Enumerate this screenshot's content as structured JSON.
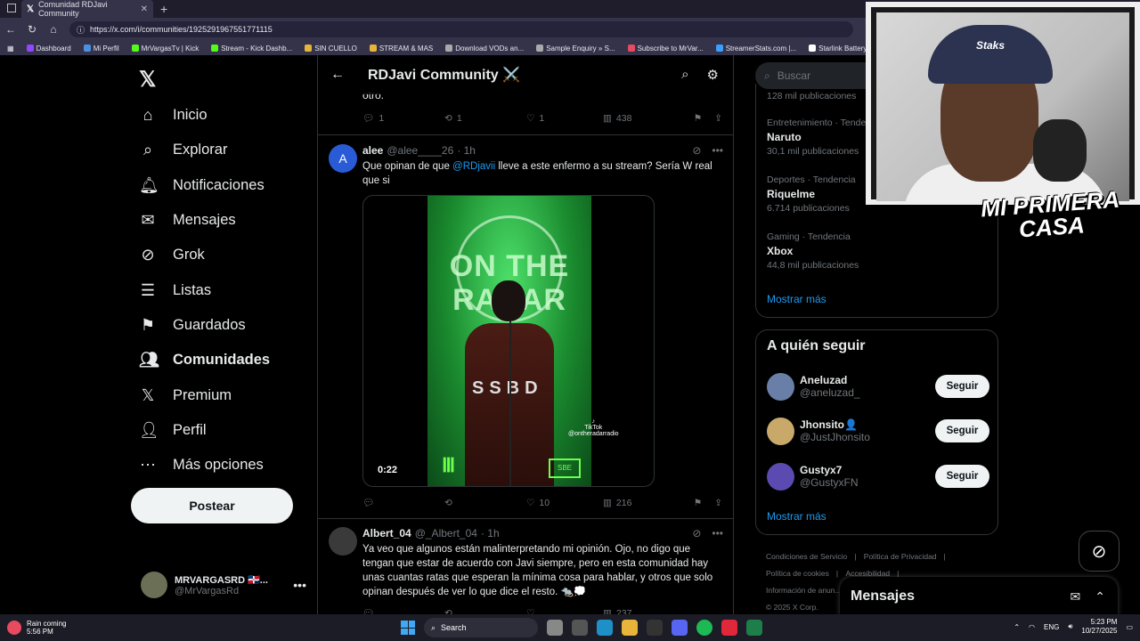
{
  "browser": {
    "tab_title": "Comunidad RDJavi Community",
    "url": "https://x.com/i/communities/1925291967551771115",
    "bookmarks": [
      "Dashboard",
      "Mi Perfil",
      "MrVargasTv | Kick",
      "Stream - Kick Dashb...",
      "SIN CUELLO",
      "STREAM & MAS",
      "Download VODs an...",
      "Sample Enquiry » S...",
      "Subscribe to MrVar...",
      "StreamerStats.com |...",
      "Starlink Battery Pow..."
    ]
  },
  "nav": {
    "items": [
      {
        "label": "Inicio",
        "icon": "home-icon",
        "glyph": "⌂"
      },
      {
        "label": "Explorar",
        "icon": "search-icon",
        "glyph": "⌕"
      },
      {
        "label": "Notificaciones",
        "icon": "bell-icon",
        "glyph": "🔔︎"
      },
      {
        "label": "Mensajes",
        "icon": "mail-icon",
        "glyph": "✉"
      },
      {
        "label": "Grok",
        "icon": "grok-icon",
        "glyph": "⊘"
      },
      {
        "label": "Listas",
        "icon": "list-icon",
        "glyph": "☰"
      },
      {
        "label": "Guardados",
        "icon": "bookmark-icon",
        "glyph": "⚑"
      },
      {
        "label": "Comunidades",
        "icon": "communities-icon",
        "glyph": "👥︎"
      },
      {
        "label": "Premium",
        "icon": "x-premium-icon",
        "glyph": "𝕏"
      },
      {
        "label": "Perfil",
        "icon": "person-icon",
        "glyph": "👤︎"
      },
      {
        "label": "Más opciones",
        "icon": "more-circle-icon",
        "glyph": "⋯"
      }
    ],
    "post_label": "Postear",
    "me": {
      "name": "MRVARGASRD 🇩🇴...",
      "handle": "@MrVargasRd"
    }
  },
  "header": {
    "title": "RDJavi Community ⚔️"
  },
  "previous_tweet": {
    "text_tail": "otro.",
    "replies": "1",
    "retweets": "1",
    "likes": "1",
    "views": "438"
  },
  "tweet1": {
    "name": "alee",
    "handle": "@alee____26",
    "time": "· 1h",
    "text_before": "Que opinan de que ",
    "mention": "@RDjavii",
    "text_after": " lleve a este enfermo a su stream? Sería W real que si",
    "video_duration": "0:22",
    "video_overlay": {
      "sign": "ON THE RADAR",
      "jacket": "SSBD",
      "tiktok": "TikTok",
      "tiktok_handle": "@ontheradarradio"
    },
    "replies": "",
    "retweets": "",
    "likes": "10",
    "views": "216"
  },
  "tweet2": {
    "name": "Albert_04",
    "handle": "@_Albert_04",
    "time": "· 1h",
    "text": "Ya veo que algunos están malinterpretando mi opinión. Ojo, no digo que tengan que estar de acuerdo con Javi siempre, pero en esta comunidad hay unas cuantas ratas que esperan la mínima cosa para hablar, y otros que solo opinan después de ver lo que dice el resto. 🐀💭",
    "views": "237"
  },
  "search": {
    "placeholder": "Buscar"
  },
  "trends": {
    "top_count": "128 mil publicaciones",
    "items": [
      {
        "meta": "Entretenimiento · Tendencia",
        "name": "Naruto",
        "count": "30,1 mil publicaciones"
      },
      {
        "meta": "Deportes · Tendencia",
        "name": "Riquelme",
        "count": "6.714 publicaciones"
      },
      {
        "meta": "Gaming · Tendencia",
        "name": "Xbox",
        "count": "44,8 mil publicaciones"
      }
    ],
    "more": "Mostrar más"
  },
  "who_to_follow": {
    "title": "A quién seguir",
    "users": [
      {
        "name": "Aneluzad",
        "handle": "@aneluzad_",
        "button": "Seguir",
        "color": "#6a7fa8"
      },
      {
        "name": "Jhonsito👤",
        "handle": "@JustJhonsito",
        "button": "Seguir",
        "color": "#c9a96a"
      },
      {
        "name": "Gustyx7",
        "handle": "@GustyxFN",
        "button": "Seguir",
        "color": "#5b4ab0"
      }
    ],
    "more": "Mostrar más"
  },
  "footer": {
    "links": [
      "Condiciones de Servicio",
      "Política de Privacidad",
      "Política de cookies",
      "Accesibilidad",
      "Información de anun..."
    ],
    "copyright": "© 2025 X Corp."
  },
  "messages_dock": {
    "title": "Mensajes"
  },
  "webcam": {
    "cap_text": "Staks",
    "overlay_title": "MI PRIMERA CASA"
  },
  "taskbar": {
    "weather_title": "Rain coming",
    "weather_time": "5:56 PM",
    "search": "Search",
    "lang": "ENG",
    "time": "5:23 PM",
    "date": "10/27/2025"
  }
}
